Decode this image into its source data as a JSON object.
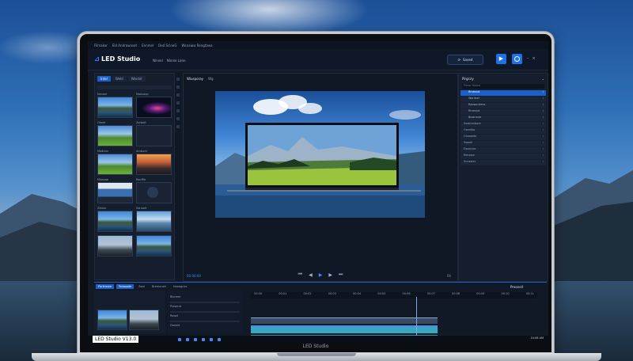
{
  "app": {
    "name": "LED Studio",
    "version_label": "LED Studio V13.0",
    "chin_label": "LED Studio"
  },
  "menubar": [
    "Filmaker",
    "Eld Andrawaset",
    "Ennmel",
    "Ded ScineG",
    "Wanaiwa Rengtawa"
  ],
  "titlebar": {
    "menu": [
      "Ninnel",
      "Ninnie Lann"
    ],
    "save_label": "Saved"
  },
  "library": {
    "tabs": [
      "Intel",
      "Weld",
      "Wardel"
    ],
    "labels": [
      "Nenoer",
      "Maasoop",
      "Ohoer",
      "Zorbolt",
      "Madiear",
      "Ambunt",
      "Miassae",
      "Reoffle",
      "Zeloor",
      "Sonoolt"
    ]
  },
  "preview": {
    "tabs": [
      "Wiusporay",
      "Wg"
    ],
    "timecode": "00:00:00",
    "zoom": "Fit"
  },
  "properties": {
    "title": "Pirgsiry",
    "search_placeholder": "Pilnar Name",
    "rows": [
      {
        "label": "Rmesiut",
        "active": true
      },
      {
        "label": "Wontser",
        "active": false
      },
      {
        "label": "Roowaukess",
        "active": false
      },
      {
        "label": "Rmesiut",
        "active": false
      },
      {
        "label": "Bownone",
        "active": false
      },
      {
        "label": "Sowhanbare",
        "active": false
      },
      {
        "label": "Owmiko",
        "active": false
      },
      {
        "label": "Oluwanbi",
        "active": false
      },
      {
        "label": "Sweoll",
        "active": false
      },
      {
        "label": "Dounceo",
        "active": false
      },
      {
        "label": "Rehaise",
        "active": false
      },
      {
        "label": "Sunewer",
        "active": false
      }
    ]
  },
  "timeline": {
    "tabs": [
      "Porlinewe",
      "Tonasade",
      "Boal",
      "Bremonek",
      "Haeagnes"
    ],
    "right_label": "Preonell",
    "ruler": [
      "00:00",
      "00:01",
      "00:02",
      "00:03",
      "00:04",
      "00:05",
      "00:06",
      "00:07",
      "00:08",
      "00:09",
      "00:10",
      "00:11"
    ],
    "track_names": [
      "Bioneer",
      "Prosand",
      "Rowel",
      "Dowed"
    ]
  },
  "taskbar": {
    "clock": "10:08 AM"
  }
}
